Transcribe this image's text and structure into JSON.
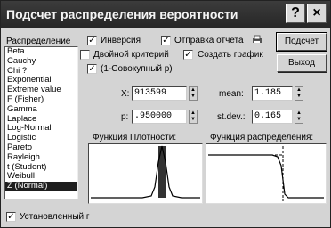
{
  "window": {
    "title": "Подсчет распределения вероятности"
  },
  "titlebar": {
    "help_glyph": "?",
    "close_glyph": "×"
  },
  "distribution": {
    "label": "Распределение",
    "items": [
      "Beta",
      "Cauchy",
      "Chi ?",
      "Exponential",
      "Extreme value",
      "F (Fisher)",
      "Gamma",
      "Laplace",
      "Log-Normal",
      "Logistic",
      "Pareto",
      "Rayleigh",
      "t (Student)",
      "Weibull",
      "Z (Normal)"
    ],
    "selected": "Z (Normal)"
  },
  "options": {
    "inversion": {
      "label": "Инверсия",
      "checked": true
    },
    "send_report": {
      "label": "Отправка отчета",
      "checked": true
    },
    "double_criterion": {
      "label": "Двойной критерий",
      "checked": false
    },
    "create_graph": {
      "label": "Создать график",
      "checked": true
    },
    "one_minus_p": {
      "label": "(1-Совокупный p)",
      "checked": true
    },
    "fixed": {
      "label": "Установленный г",
      "checked": true
    }
  },
  "buttons": {
    "calculate": "Подсчет",
    "exit": "Выход"
  },
  "fields": {
    "x": {
      "label": "X:",
      "value": "913599"
    },
    "p": {
      "label": "p:",
      "value": ".950000"
    },
    "mean": {
      "label": "mean:",
      "value": "1.185"
    },
    "stdev": {
      "label": "st.dev.:",
      "value": "0.165"
    }
  },
  "charts": {
    "density_label": "Функция Плотности:",
    "cumulative_label": "Функция распределения:"
  },
  "colors": {
    "titlebar": "#2e2e2e",
    "selection": "#1e1e1e",
    "window": "#d4d4d4"
  }
}
